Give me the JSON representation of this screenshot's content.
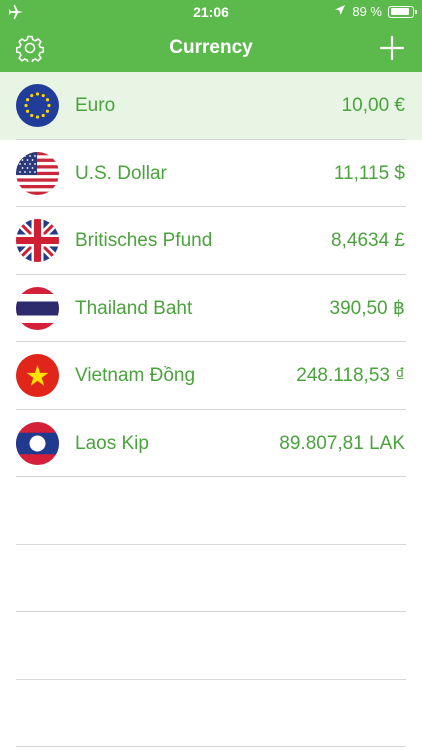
{
  "status_bar": {
    "time": "21:06",
    "battery_text": "89 %",
    "battery_level": 0.89,
    "icons": [
      "airplane-icon",
      "location-arrow-icon",
      "battery-icon"
    ]
  },
  "nav": {
    "title": "Currency",
    "left_icon": "gear-icon",
    "right_icon": "plus-icon"
  },
  "colors": {
    "accent": "#5cb94c",
    "text_green": "#4aa33c",
    "selected_row": "#e8f5e4"
  },
  "currencies": [
    {
      "name": "Euro",
      "value": "10,00 €",
      "flag": "eu-flag-icon",
      "selected": true
    },
    {
      "name": "U.S. Dollar",
      "value": "11,115 $",
      "flag": "us-flag-icon",
      "selected": false
    },
    {
      "name": "Britisches Pfund",
      "value": "8,4634 £",
      "flag": "uk-flag-icon",
      "selected": false
    },
    {
      "name": "Thailand Baht",
      "value": "390,50 ฿",
      "flag": "thailand-flag-icon",
      "selected": false
    },
    {
      "name": "Vietnam Đồng",
      "value": "248.118,53 ₫",
      "flag": "vietnam-flag-icon",
      "selected": false
    },
    {
      "name": "Laos Kip",
      "value": "89.807,81 LAK",
      "flag": "laos-flag-icon",
      "selected": false
    }
  ]
}
